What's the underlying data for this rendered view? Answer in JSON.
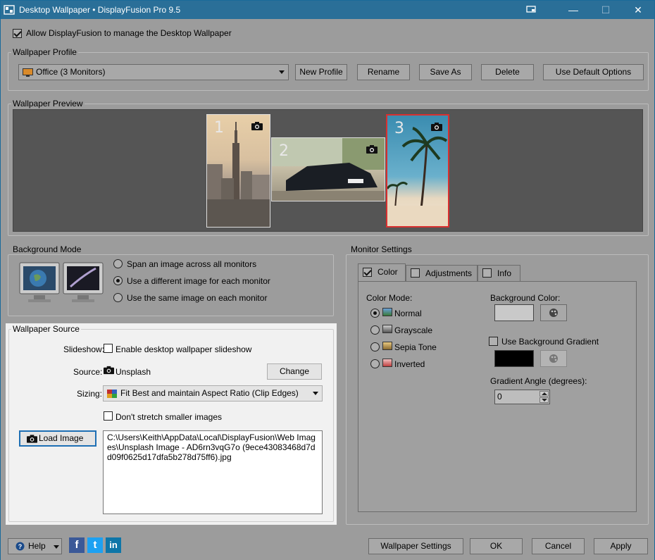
{
  "window": {
    "title": "Desktop Wallpaper • DisplayFusion Pro 9.5",
    "minimize_glyph": "—",
    "maximize_glyph": "☐",
    "close_glyph": "✕"
  },
  "allow_manage": {
    "label": "Allow DisplayFusion to manage the Desktop Wallpaper",
    "checked": true
  },
  "profile": {
    "group_title": "Wallpaper Profile",
    "selected": "Office (3 Monitors)",
    "buttons": {
      "new": "New Profile",
      "rename": "Rename",
      "save_as": "Save As",
      "delete": "Delete",
      "default": "Use Default Options"
    }
  },
  "preview": {
    "group_title": "Wallpaper Preview",
    "monitors": [
      {
        "number": "1"
      },
      {
        "number": "2"
      },
      {
        "number": "3"
      }
    ]
  },
  "background_mode": {
    "group_title": "Background Mode",
    "options": [
      {
        "label": "Span an image across all monitors",
        "selected": false
      },
      {
        "label": "Use a different image for each monitor",
        "selected": true
      },
      {
        "label": "Use the same image on each monitor",
        "selected": false
      }
    ]
  },
  "source": {
    "group_title": "Wallpaper Source",
    "slideshow_label": "Slideshow:",
    "slideshow_option": "Enable desktop wallpaper slideshow",
    "source_label": "Source:",
    "source_value": "Unsplash",
    "change_button": "Change",
    "sizing_label": "Sizing:",
    "sizing_value": "Fit Best and maintain Aspect Ratio (Clip Edges)",
    "dont_stretch": "Don't stretch smaller images",
    "load_image_button": "Load Image",
    "image_path": "C:\\Users\\Keith\\AppData\\Local\\DisplayFusion\\Web Images\\Unsplash Image - AD6rn3vqG7o (9ece43083468d7dd09f0625d17dfa5b278d75ff6).jpg"
  },
  "monitor_settings": {
    "group_title": "Monitor Settings",
    "tabs": [
      "Color",
      "Adjustments",
      "Info"
    ],
    "color_mode_label": "Color Mode:",
    "color_modes": [
      {
        "label": "Normal",
        "selected": true
      },
      {
        "label": "Grayscale",
        "selected": false
      },
      {
        "label": "Sepia Tone",
        "selected": false
      },
      {
        "label": "Inverted",
        "selected": false
      }
    ],
    "background_color_label": "Background Color:",
    "background_color": "#c9c9c9",
    "use_gradient_label": "Use Background Gradient",
    "gradient_color": "#000000",
    "gradient_angle_label": "Gradient Angle (degrees):",
    "gradient_angle_value": "0"
  },
  "footer": {
    "help": "Help",
    "wallpaper_settings": "Wallpaper Settings",
    "ok": "OK",
    "cancel": "Cancel",
    "apply": "Apply",
    "social": {
      "facebook": "f",
      "twitter": "t",
      "linkedin": "in"
    }
  }
}
